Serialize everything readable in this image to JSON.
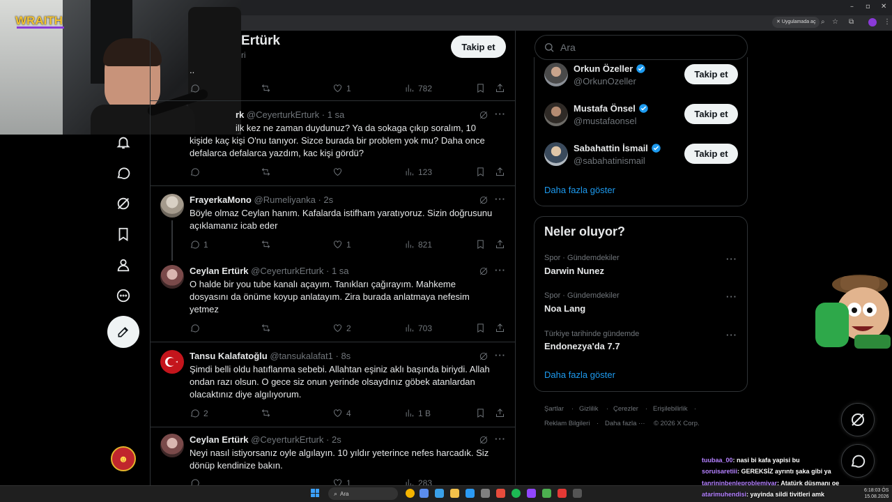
{
  "browser": {
    "app_chip": "Uygulamada aç"
  },
  "webcam": {
    "overlay_logo": "WRAITH"
  },
  "header": {
    "profile_name": "Ertürk",
    "profile_sub": "ri",
    "follow_label": "Takip et"
  },
  "tweets": [
    {
      "name": "",
      "handle": "",
      "time": "",
      "text": "..",
      "reply": "",
      "retweet": "",
      "like": "1",
      "views": "782"
    },
    {
      "name": "rk",
      "handle": "@CeyerturkErturk",
      "time": "1 sa",
      "text": "ilk kez ne zaman duydunuz? Ya da sokaga çıkıp soralım, 10 kişide kaç kişi O'nu tanıyor. Sizce burada bir problem yok mu? Daha once defalarca defalarca yazdım, kac kişi gördü?",
      "reply": "",
      "retweet": "",
      "like": "",
      "views": "123"
    },
    {
      "name": "FrayerkaMono",
      "handle": "@Rumeliyanka",
      "time": "2s",
      "text": "Böyle olmaz Ceylan hanım. Kafalarda istifham yaratıyoruz. Sizin doğrusunu açıklamanız icab eder",
      "reply": "1",
      "retweet": "",
      "like": "1",
      "views": "821"
    },
    {
      "name": "Ceylan Ertürk",
      "handle": "@CeyerturkErturk",
      "time": "1 sa",
      "text": "O halde bir you tube kanalı açayım.  Tanıkları çağırayım.  Mahkeme dosyasını da önüme koyup anlatayım.  Zira burada anlatmaya nefesim yetmez",
      "reply": "",
      "retweet": "",
      "like": "2",
      "views": "703"
    },
    {
      "name": "Tansu Kalafatoğlu",
      "handle": "@tansukalafat1",
      "time": "8s",
      "text": "Şimdi belli oldu hatıflanma sebebi. Allahtan eşiniz aklı başında biriydi. Allah ondan razı olsun. O gece siz onun yerinde olsaydınız göbek atanlardan olacaktınız diye algılıyorum.",
      "reply": "2",
      "retweet": "",
      "like": "4",
      "views": "1 B"
    },
    {
      "name": "Ceylan Ertürk",
      "handle": "@CeyerturkErturk",
      "time": "2s",
      "text": "Neyi nasıl istiyorsanız oyle algılayın. 10 yıldır yeterince nefes harcadık.  Siz dönüp kendinize bakın.",
      "reply": "",
      "retweet": "",
      "like": "1",
      "views": "283"
    }
  ],
  "sidebar": {
    "search_placeholder": "Ara",
    "who_to_follow": [
      {
        "name": "Orkun Özeller",
        "handle": "@OrkunOzeller",
        "button": "Takip et"
      },
      {
        "name": "Mustafa Önsel",
        "handle": "@mustafaonsel",
        "button": "Takip et"
      },
      {
        "name": "Sabahattin İsmail",
        "handle": "@sabahatinismail",
        "button": "Takip et"
      }
    ],
    "show_more": "Daha fazla göster",
    "trends_title": "Neler oluyor?",
    "trends": [
      {
        "category": "Spor · Gündemdekiler",
        "name": "Darwin Nunez"
      },
      {
        "category": "Spor · Gündemdekiler",
        "name": "Noa Lang"
      },
      {
        "category": "Türkiye tarihinde gündemde",
        "name": "Endonezya'da 7.7"
      }
    ],
    "trends_show_more": "Daha fazla göster",
    "footer": {
      "terms": "Şartlar",
      "privacy": "Gizlilik",
      "cookies": "Çerezler",
      "accessibility": "Erişilebilirlik",
      "ads": "Reklam Bilgileri",
      "more": "Daha fazla ···",
      "copyright": "© 2026 X Corp."
    }
  },
  "chat": [
    {
      "user": "tuubaa_00",
      "message": ": nasi bi kafa yapisi bu"
    },
    {
      "user": "soruisaretiii",
      "message": ": GEREKSİZ ayrıntı şaka gibi ya"
    },
    {
      "user": "tanrininbenleproblemivar",
      "message": ": Atatürk düşmanı oe"
    },
    {
      "user": "atarimuhendisi",
      "message": ": yayinda sildi tivitleri amk"
    }
  ],
  "taskbar": {
    "search_label": "Ara",
    "time": "6:18:03 ÖS",
    "date": "15.08.2026"
  },
  "colors": {
    "accent": "#1d9bf0",
    "background": "#000000",
    "border": "#2f3336",
    "muted": "#71767b"
  }
}
